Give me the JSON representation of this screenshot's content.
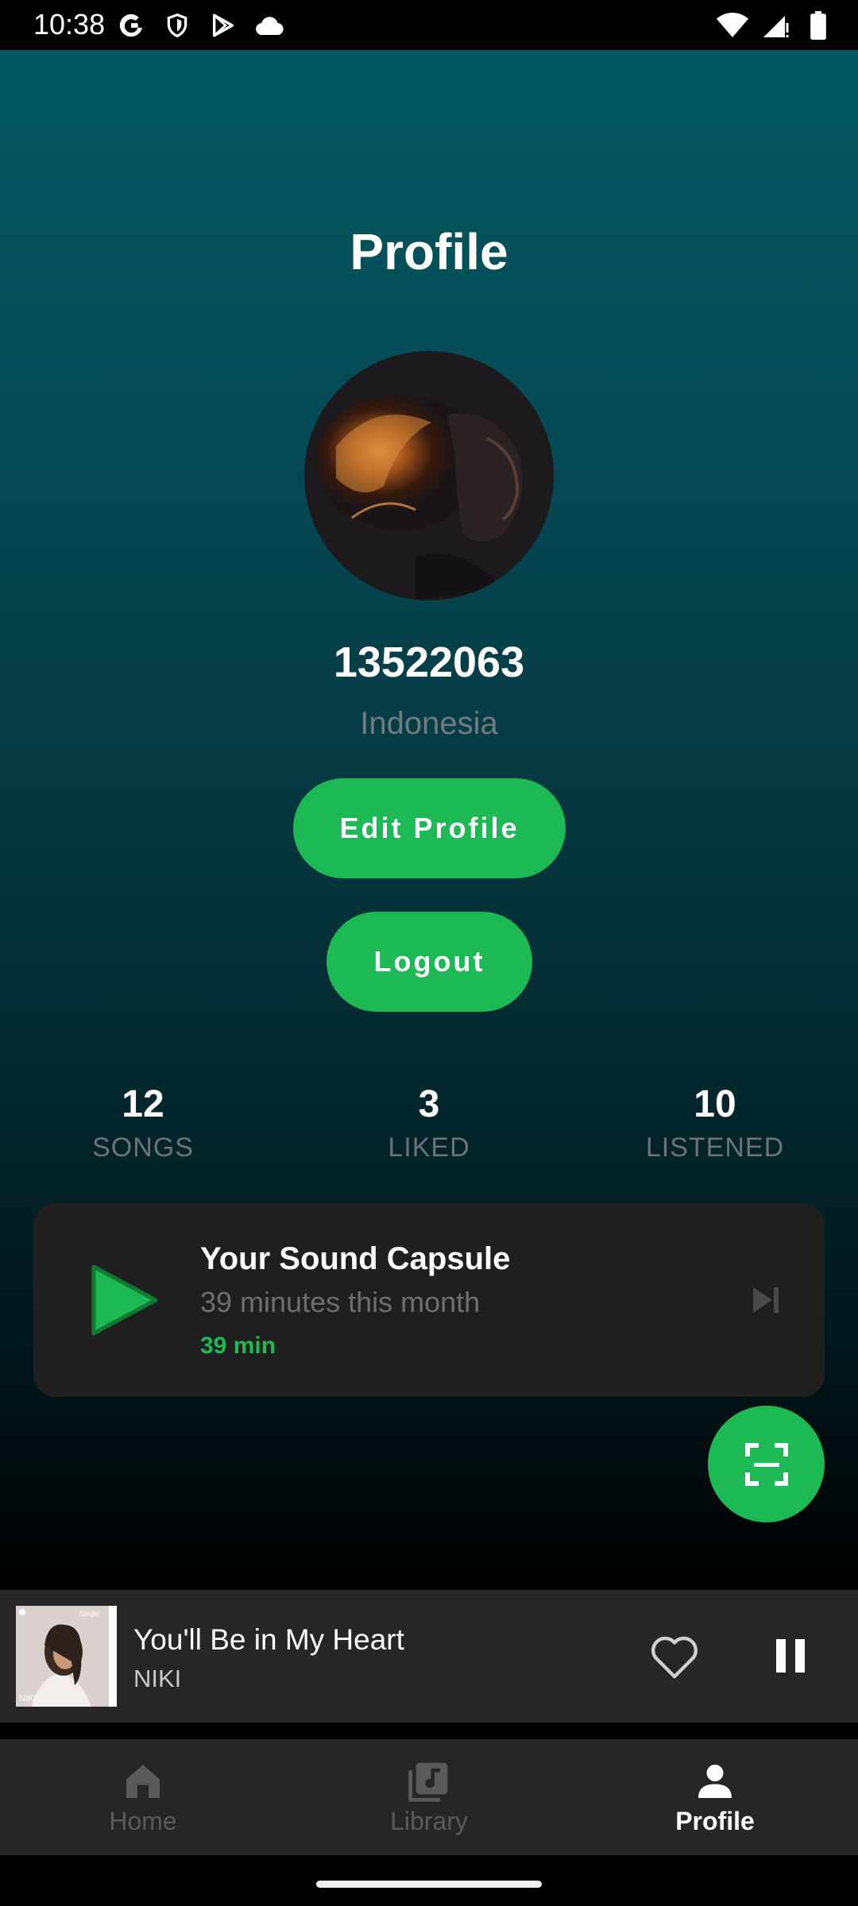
{
  "status_bar": {
    "time": "10:38",
    "left_icons": [
      "google-icon",
      "shield-icon",
      "play-store-icon",
      "cloud-icon"
    ],
    "right_icons": [
      "wifi-icon",
      "cell-signal-icon",
      "battery-icon"
    ]
  },
  "profile": {
    "title": "Profile",
    "username": "13522063",
    "country": "Indonesia",
    "edit_button": "Edit Profile",
    "logout_button": "Logout"
  },
  "stats": [
    {
      "value": "12",
      "label": "SONGS"
    },
    {
      "value": "3",
      "label": "LIKED"
    },
    {
      "value": "10",
      "label": "LISTENED"
    }
  ],
  "sound_capsule": {
    "title": "Your Sound Capsule",
    "subtitle": "39 minutes this month",
    "minutes": "39 min"
  },
  "mini_player": {
    "title": "You'll Be in My Heart",
    "artist": "NIKI",
    "art_caption": "NIKI",
    "art_tag": "Single",
    "liked": false,
    "playing": true
  },
  "bottom_nav": {
    "items": [
      {
        "label": "Home",
        "icon": "home-icon",
        "active": false
      },
      {
        "label": "Library",
        "icon": "library-icon",
        "active": false
      },
      {
        "label": "Profile",
        "icon": "person-icon",
        "active": true
      }
    ]
  },
  "colors": {
    "accent": "#1db954",
    "gradient_top": "#03585f",
    "card": "#1f1f1f",
    "bar": "#262626"
  }
}
